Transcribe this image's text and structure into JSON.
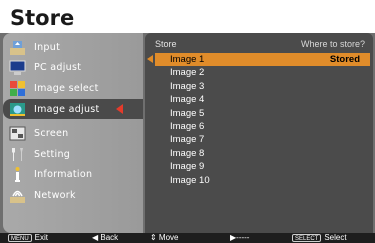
{
  "title": "Store",
  "sidebar": {
    "items": [
      {
        "label": "Input",
        "icon": "input-icon"
      },
      {
        "label": "PC adjust",
        "icon": "pc-adjust-icon"
      },
      {
        "label": "Image select",
        "icon": "image-select-icon"
      },
      {
        "label": "Image adjust",
        "icon": "image-adjust-icon",
        "active": true
      },
      {
        "label": "Screen",
        "icon": "screen-icon"
      },
      {
        "label": "Setting",
        "icon": "setting-icon"
      },
      {
        "label": "Information",
        "icon": "information-icon"
      },
      {
        "label": "Network",
        "icon": "network-icon"
      }
    ]
  },
  "panel": {
    "header_left": "Store",
    "header_right": "Where to store?",
    "rows": [
      {
        "label": "Image 1",
        "status": "Stored"
      },
      {
        "label": "Image 2",
        "status": ""
      },
      {
        "label": "Image 3",
        "status": ""
      },
      {
        "label": "Image 4",
        "status": ""
      },
      {
        "label": "Image 5",
        "status": ""
      },
      {
        "label": "Image 6",
        "status": ""
      },
      {
        "label": "Image 7",
        "status": ""
      },
      {
        "label": "Image 8",
        "status": ""
      },
      {
        "label": "Image 9",
        "status": ""
      },
      {
        "label": "Image 10",
        "status": ""
      }
    ]
  },
  "footer": {
    "exit_key": "MENU",
    "exit": "Exit",
    "back": "◀ Back",
    "move": "⇕ Move",
    "next": "▶-----",
    "select_key": "SELECT",
    "select": "Select"
  },
  "colors": {
    "selection": "#e08c2a",
    "active_arrow": "#e53b2b",
    "panel": "#4b4b4b",
    "sidebar": "#a9a9a9"
  }
}
